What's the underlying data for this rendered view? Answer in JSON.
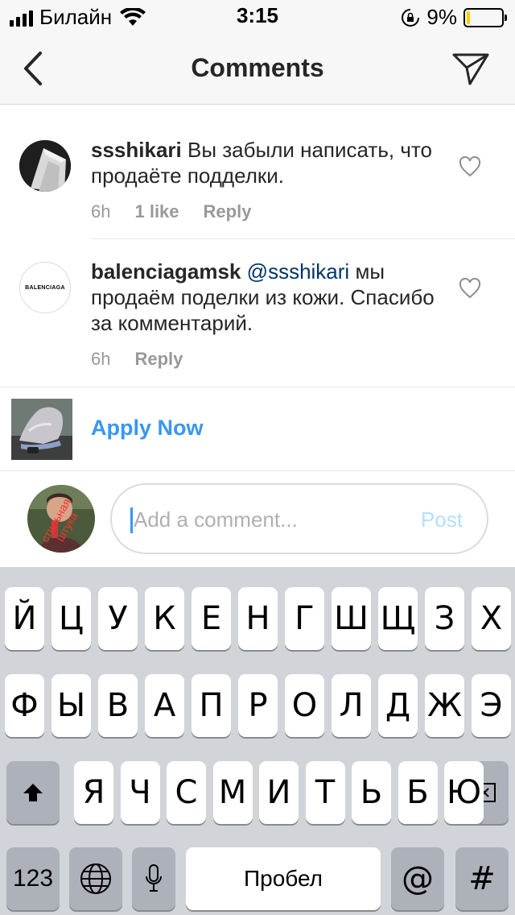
{
  "status_bar": {
    "carrier": "Билайн",
    "time": "3:15",
    "battery_percent": "9%",
    "battery_level": 0.09,
    "icons": [
      "signal-icon",
      "wifi-icon",
      "rotation-lock-icon",
      "battery-icon"
    ]
  },
  "nav": {
    "title": "Comments",
    "back_icon": "chevron-left-icon",
    "share_icon": "paper-plane-icon"
  },
  "comments": [
    {
      "username": "ssshikari",
      "mention": "",
      "text": "Вы забыли написать, что продаёте подделки.",
      "time": "6h",
      "likes": "1 like",
      "reply": "Reply"
    },
    {
      "username": "balenciagamsk",
      "mention": "@ssshikari",
      "text": "мы продаём поделки из кожи. Спасибо за комментарий.",
      "time": "6h",
      "likes": "",
      "reply": "Reply",
      "avatar_logo": "BALENCIAGA"
    }
  ],
  "ad": {
    "cta": "Apply Now"
  },
  "composer": {
    "placeholder": "Add a comment...",
    "post_label": "Post",
    "avatar_sticker": "стильная штука"
  },
  "keyboard": {
    "row1": [
      "Й",
      "Ц",
      "У",
      "К",
      "Е",
      "Н",
      "Г",
      "Ш",
      "Щ",
      "З",
      "Х"
    ],
    "row2": [
      "Ф",
      "Ы",
      "В",
      "А",
      "П",
      "Р",
      "О",
      "Л",
      "Д",
      "Ж",
      "Э"
    ],
    "row3": [
      "Я",
      "Ч",
      "С",
      "М",
      "И",
      "Т",
      "Ь",
      "Б",
      "Ю"
    ],
    "numbers_label": "123",
    "space_label": "Пробел",
    "at_label": "@",
    "hash_label": "#"
  },
  "colors": {
    "link": "#3897f0",
    "mention": "#003569",
    "meta": "#999999",
    "post_disabled": "#b2dffc",
    "keyboard_bg": "#d1d4d9"
  }
}
